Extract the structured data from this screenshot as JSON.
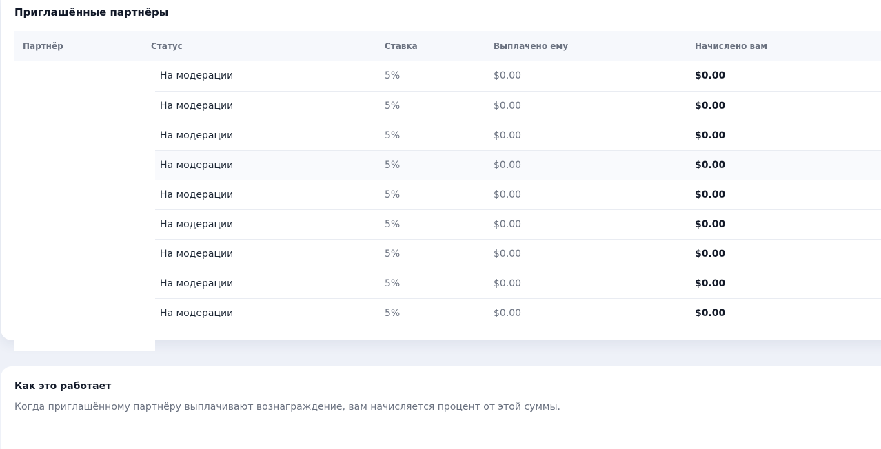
{
  "partners_section": {
    "title": "Приглашённые партнёры",
    "columns": {
      "partner": "Партнёр",
      "status": "Статус",
      "rate": "Ставка",
      "paid_to_him": "Выплачено ему",
      "credited_to_you": "Начислено вам"
    },
    "rows": [
      {
        "status": "На модерации",
        "rate": "5%",
        "paid": "$0.00",
        "earned": "$0.00"
      },
      {
        "status": "На модерации",
        "rate": "5%",
        "paid": "$0.00",
        "earned": "$0.00"
      },
      {
        "status": "На модерации",
        "rate": "5%",
        "paid": "$0.00",
        "earned": "$0.00"
      },
      {
        "status": "На модерации",
        "rate": "5%",
        "paid": "$0.00",
        "earned": "$0.00"
      },
      {
        "status": "На модерации",
        "rate": "5%",
        "paid": "$0.00",
        "earned": "$0.00"
      },
      {
        "status": "На модерации",
        "rate": "5%",
        "paid": "$0.00",
        "earned": "$0.00"
      },
      {
        "status": "На модерации",
        "rate": "5%",
        "paid": "$0.00",
        "earned": "$0.00"
      },
      {
        "status": "На модерации",
        "rate": "5%",
        "paid": "$0.00",
        "earned": "$0.00"
      },
      {
        "status": "На модерации",
        "rate": "5%",
        "paid": "$0.00",
        "earned": "$0.00"
      }
    ]
  },
  "how_it_works": {
    "title": "Как это работает",
    "text": "Когда приглашённому партнёру выплачивают вознаграждение, вам начисляется процент от этой суммы."
  }
}
